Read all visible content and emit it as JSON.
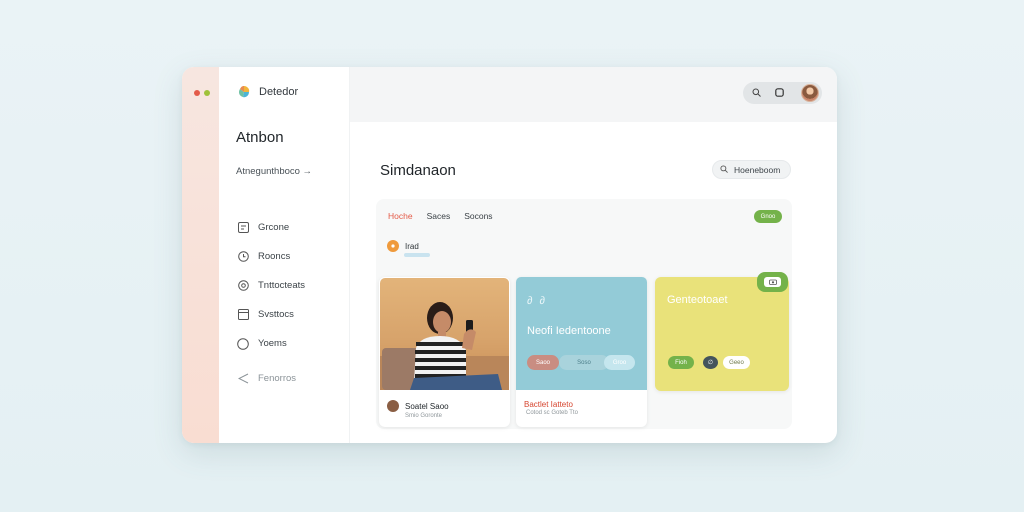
{
  "window": {
    "brand": "Detedor",
    "accent": "#e45a47",
    "green": "#74b24a"
  },
  "sidebar": {
    "title": "Atnbon",
    "subtitle": "Atnegunthboco →",
    "items": [
      {
        "label": "Grcone",
        "icon": "calendar-icon"
      },
      {
        "label": "Rooncs",
        "icon": "clock-icon"
      },
      {
        "label": "Tnttocteats",
        "icon": "target-icon"
      },
      {
        "label": "Svsttocs",
        "icon": "window-icon"
      },
      {
        "label": "Yoems",
        "icon": "circle-icon"
      }
    ],
    "footer_item": {
      "label": "Fenorros",
      "icon": "send-icon"
    }
  },
  "topbar": {
    "icons": [
      "search-icon",
      "square-icon"
    ]
  },
  "main": {
    "title": "Simdanaon",
    "button_label": "Hoeneboom",
    "tabs": [
      "Hoche",
      "Saces",
      "Socons"
    ],
    "badge": "Gnoo",
    "row_label": "Irad"
  },
  "cards": [
    {
      "kind": "photo",
      "name": "Soatel Saoo",
      "sub": "Smio Goronte"
    },
    {
      "kind": "blue",
      "icon_text": "∂ ∂",
      "title": "Neofi Iedentoone",
      "chips": [
        "Saoo",
        "Soso",
        "Groo"
      ],
      "name": "Bactlet Iatteto",
      "sub": "Cotod sc Goteb Tto"
    },
    {
      "kind": "yellow",
      "title": "Genteotoaet",
      "badge_icon": "camera-icon",
      "chips": [
        "Fioh",
        "∅",
        "Geeo"
      ]
    }
  ]
}
